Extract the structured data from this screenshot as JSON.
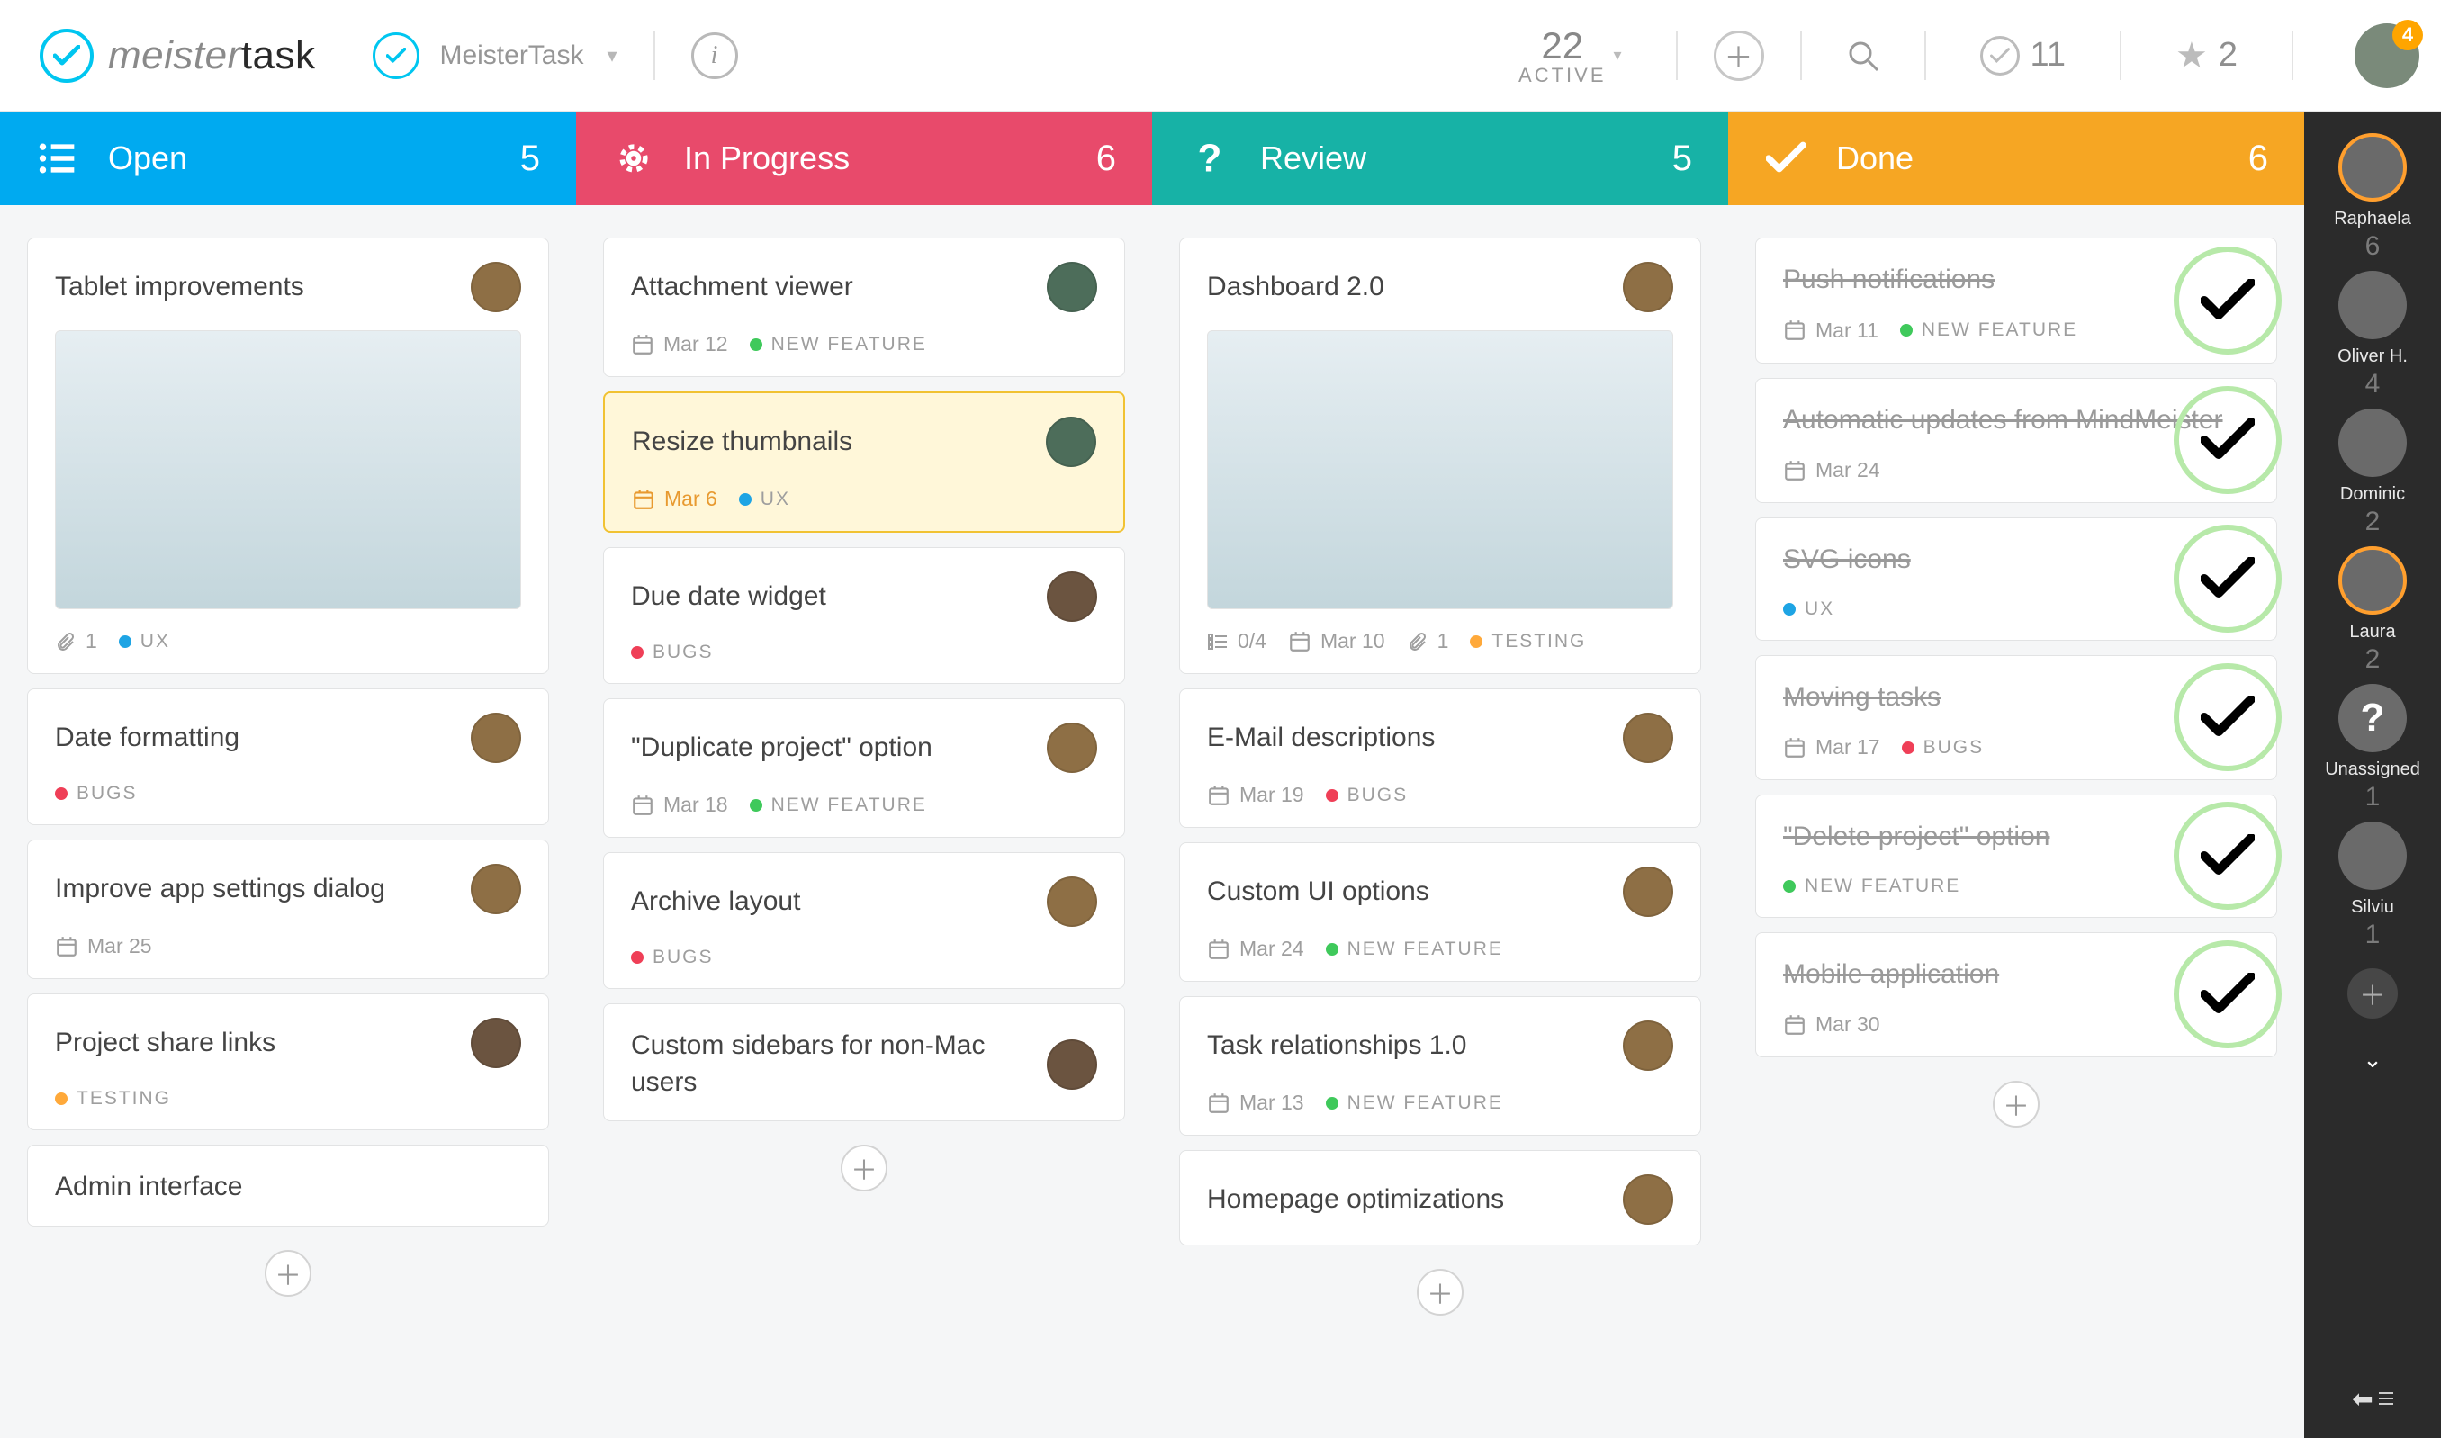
{
  "brand": {
    "a": "meister",
    "b": "task"
  },
  "project": {
    "name": "MeisterTask"
  },
  "top": {
    "activeN": "22",
    "activeLabel": "ACTIVE",
    "checkedN": "11",
    "starN": "2",
    "notif": "4"
  },
  "columns": [
    {
      "key": "open",
      "title": "Open",
      "count": "5",
      "iconName": "list-icon",
      "cards": [
        {
          "title": "Tablet improvements",
          "avatar": "av-a",
          "hasThumb": true,
          "meta": [
            {
              "t": "attach",
              "v": "1"
            },
            {
              "t": "tag",
              "color": "d-blue",
              "label": "UX"
            }
          ]
        },
        {
          "title": "Date formatting",
          "avatar": "av-a",
          "meta": [
            {
              "t": "tag",
              "color": "d-red",
              "label": "BUGS"
            }
          ]
        },
        {
          "title": "Improve app settings dialog",
          "avatar": "av-a",
          "meta": [
            {
              "t": "date",
              "v": "Mar 25"
            }
          ]
        },
        {
          "title": "Project share links",
          "avatar": "av-d",
          "meta": [
            {
              "t": "tag",
              "color": "d-orange",
              "label": "TESTING"
            }
          ]
        },
        {
          "title": "Admin interface"
        }
      ]
    },
    {
      "key": "progress",
      "title": "In Progress",
      "count": "6",
      "iconName": "gear-icon",
      "cards": [
        {
          "title": "Attachment viewer",
          "avatar": "av-b",
          "meta": [
            {
              "t": "date",
              "v": "Mar 12"
            },
            {
              "t": "tag",
              "color": "d-green",
              "label": "NEW FEATURE"
            }
          ]
        },
        {
          "title": "Resize thumbnails",
          "avatar": "av-b",
          "highlight": true,
          "meta": [
            {
              "t": "date",
              "v": "Mar 6",
              "over": true
            },
            {
              "t": "tag",
              "color": "d-blue",
              "label": "UX"
            }
          ]
        },
        {
          "title": "Due date widget",
          "avatar": "av-d",
          "meta": [
            {
              "t": "tag",
              "color": "d-red",
              "label": "BUGS"
            }
          ]
        },
        {
          "title": "\"Duplicate project\" option",
          "avatar": "av-a",
          "meta": [
            {
              "t": "date",
              "v": "Mar 18"
            },
            {
              "t": "tag",
              "color": "d-green",
              "label": "NEW FEATURE"
            }
          ]
        },
        {
          "title": "Archive layout",
          "avatar": "av-a",
          "meta": [
            {
              "t": "tag",
              "color": "d-red",
              "label": "BUGS"
            }
          ]
        },
        {
          "title": "Custom sidebars for non-Mac users",
          "avatar": "av-d"
        }
      ]
    },
    {
      "key": "review",
      "title": "Review",
      "count": "5",
      "iconName": "question-icon",
      "cards": [
        {
          "title": "Dashboard 2.0",
          "avatar": "av-a",
          "hasThumb": true,
          "meta": [
            {
              "t": "check",
              "v": "0/4"
            },
            {
              "t": "date",
              "v": "Mar 10"
            },
            {
              "t": "attach",
              "v": "1"
            },
            {
              "t": "tag",
              "color": "d-orange",
              "label": "TESTING"
            }
          ]
        },
        {
          "title": "E-Mail descriptions",
          "avatar": "av-a",
          "meta": [
            {
              "t": "date",
              "v": "Mar 19"
            },
            {
              "t": "tag",
              "color": "d-red",
              "label": "BUGS"
            }
          ]
        },
        {
          "title": "Custom UI options",
          "avatar": "av-a",
          "meta": [
            {
              "t": "date",
              "v": "Mar 24"
            },
            {
              "t": "tag",
              "color": "d-green",
              "label": "NEW FEATURE"
            }
          ]
        },
        {
          "title": "Task relationships 1.0",
          "avatar": "av-a",
          "meta": [
            {
              "t": "date",
              "v": "Mar 13"
            },
            {
              "t": "tag",
              "color": "d-green",
              "label": "NEW FEATURE"
            }
          ]
        },
        {
          "title": "Homepage optimizations",
          "avatar": "av-a"
        }
      ]
    },
    {
      "key": "done",
      "title": "Done",
      "count": "6",
      "iconName": "check-icon",
      "cards": [
        {
          "title": "Push notifications",
          "done": true,
          "meta": [
            {
              "t": "date",
              "v": "Mar 11"
            },
            {
              "t": "tag",
              "color": "d-green",
              "label": "NEW FEATURE"
            }
          ]
        },
        {
          "title": "Automatic updates from MindMeister",
          "done": true,
          "meta": [
            {
              "t": "date",
              "v": "Mar 24"
            }
          ]
        },
        {
          "title": "SVG icons",
          "done": true,
          "meta": [
            {
              "t": "tag",
              "color": "d-blue",
              "label": "UX"
            }
          ]
        },
        {
          "title": "Moving tasks",
          "done": true,
          "meta": [
            {
              "t": "date",
              "v": "Mar 17"
            },
            {
              "t": "tag",
              "color": "d-red",
              "label": "BUGS"
            }
          ]
        },
        {
          "title": "\"Delete project\" option",
          "done": true,
          "meta": [
            {
              "t": "tag",
              "color": "d-green",
              "label": "NEW FEATURE"
            }
          ]
        },
        {
          "title": "Mobile application",
          "done": true,
          "meta": [
            {
              "t": "date",
              "v": "Mar 30"
            }
          ]
        }
      ]
    }
  ],
  "members": [
    {
      "name": "Raphaela",
      "count": "6",
      "selected": true,
      "cls": "av-a"
    },
    {
      "name": "Oliver H.",
      "count": "4",
      "cls": "av-d"
    },
    {
      "name": "Dominic",
      "count": "2",
      "cls": "av-b"
    },
    {
      "name": "Laura",
      "count": "2",
      "selected": true,
      "cls": "av-c"
    },
    {
      "name": "Unassigned",
      "count": "1",
      "question": true
    },
    {
      "name": "Silviu",
      "count": "1",
      "cls": "av-e"
    }
  ]
}
